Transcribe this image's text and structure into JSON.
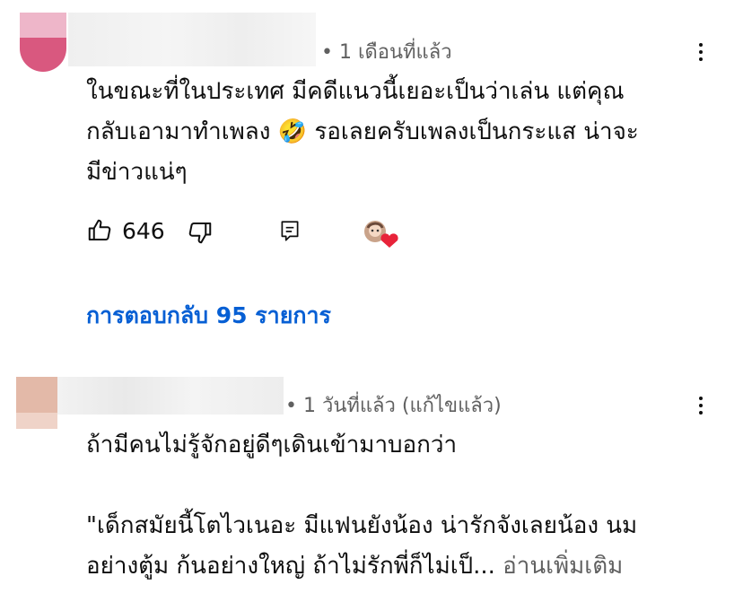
{
  "comments": [
    {
      "timestamp": "1 เดือนที่แล้ว",
      "lines": [
        "ในขณะที่ในประเทศ มีคดีแนวนี้เยอะเป็นว่าเล่น แต่คุณ",
        "กลับเอามาทำเพลง",
        "รอเลยครับเพลงเป็นกระแส น่าจะ",
        "มีข่าวแน่ๆ"
      ],
      "emoji": "🤣",
      "like_count": "646",
      "replies_label": "การตอบกลับ 95 รายการ"
    },
    {
      "timestamp": "1 วันที่แล้ว (แก้ไขแล้ว)",
      "lines": [
        "ถ้ามีคนไม่รู้จักอยู่ดีๆเดินเข้ามาบอกว่า",
        "\"เด็กสมัยนี้โตไวเนอะ มีแฟนยังน้อง น่ารักจังเลยน้อง นม",
        "อย่างตู้ม ก้นอย่างใหญ่ ถ้าไม่รักพี่ก็ไม่เป็..."
      ],
      "read_more": "อ่านเพิ่มเติม"
    }
  ],
  "colors": {
    "link": "#065fd4",
    "meta": "#606060",
    "heart": "#e8233a"
  }
}
